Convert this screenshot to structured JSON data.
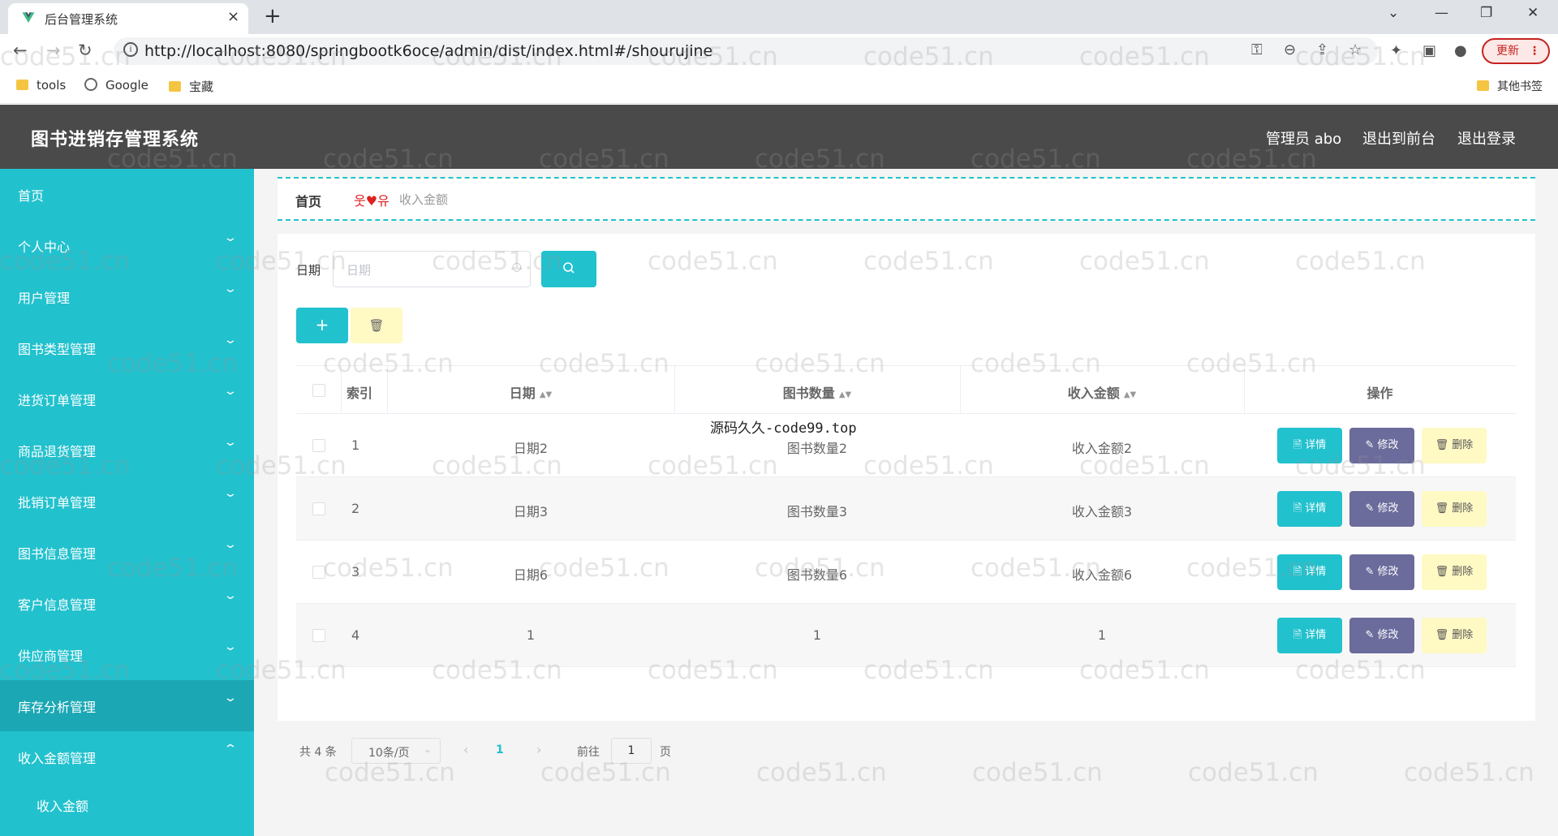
{
  "browser": {
    "tab_title": "后台管理系统",
    "tab_close": "×",
    "new_tab": "+",
    "window_controls": [
      "⌄",
      "—",
      "❐",
      "✕"
    ],
    "url": "http://localhost:8080/springbootk6oce/admin/dist/index.html#/shourujine",
    "update_label": "更新",
    "bookmarks": [
      {
        "label": "tools",
        "icon": "folder-icon"
      },
      {
        "label": "Google",
        "icon": "globe-icon"
      },
      {
        "label": "宝藏",
        "icon": "folder-icon"
      }
    ],
    "other_bookmarks": "其他书签"
  },
  "header": {
    "title": "图书进销存管理系统",
    "admin_label": "管理员 abo",
    "front_link": "退出到前台",
    "logout_link": "退出登录"
  },
  "sidebar": {
    "items": [
      {
        "label": "首页"
      },
      {
        "label": "个人中心",
        "arrow": "⌄"
      },
      {
        "label": "用户管理",
        "arrow": "⌄"
      },
      {
        "label": "图书类型管理",
        "arrow": "⌄"
      },
      {
        "label": "进货订单管理",
        "arrow": "⌄"
      },
      {
        "label": "商品退货管理",
        "arrow": "⌄"
      },
      {
        "label": "批销订单管理",
        "arrow": "⌄"
      },
      {
        "label": "图书信息管理",
        "arrow": "⌄"
      },
      {
        "label": "客户信息管理",
        "arrow": "⌄"
      },
      {
        "label": "供应商管理",
        "arrow": "⌄"
      },
      {
        "label": "库存分析管理",
        "arrow": "⌄"
      },
      {
        "label": "收入金额管理",
        "arrow": "⌃"
      }
    ],
    "sub_items": [
      {
        "label": "收入金额"
      }
    ]
  },
  "breadcrumb": {
    "home": "首页",
    "separator": "웃♥유",
    "current": "收入金额"
  },
  "search": {
    "label": "日期",
    "placeholder": "日期",
    "search_icon": "search-icon"
  },
  "actions": {
    "add": "+",
    "batch_delete": "🗑"
  },
  "table": {
    "headers": {
      "index": "索引",
      "date": "日期",
      "book_count": "图书数量",
      "income": "收入金额",
      "ops": "操作"
    },
    "rows": [
      {
        "index": "1",
        "date": "日期2",
        "book_count": "图书数量2",
        "income": "收入金额2"
      },
      {
        "index": "2",
        "date": "日期3",
        "book_count": "图书数量3",
        "income": "收入金额3"
      },
      {
        "index": "3",
        "date": "日期6",
        "book_count": "图书数量6",
        "income": "收入金额6"
      },
      {
        "index": "4",
        "date": "1",
        "book_count": "1",
        "income": "1"
      }
    ],
    "op_labels": {
      "detail": "🗎 详情",
      "edit": "✎ 修改",
      "delete": "🗑 删除"
    }
  },
  "pagination": {
    "total": "共 4 条",
    "page_size": "10条/页",
    "current_page": "1",
    "goto_label": "前往",
    "goto_value": "1",
    "page_suffix": "页"
  },
  "overlay_text": "源码久久-code99.top",
  "watermark": "code51.cn",
  "colors": {
    "accent": "#22c1ce",
    "header_bg": "#4a4a4a",
    "edit_btn": "#6b6b9c",
    "delete_btn": "#fff9c4"
  }
}
